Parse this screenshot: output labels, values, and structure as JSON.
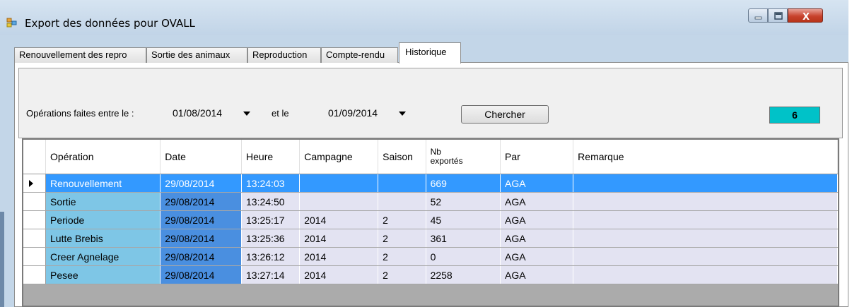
{
  "window": {
    "title": "Export des données pour OVALL",
    "close_symbol": "X"
  },
  "tabs": [
    {
      "label": "Renouvellement des repro"
    },
    {
      "label": "Sortie des animaux"
    },
    {
      "label": "Reproduction"
    },
    {
      "label": "Compte-rendu"
    },
    {
      "label": "Historique",
      "active": true
    }
  ],
  "filter": {
    "label_between": "Opérations faites entre le :",
    "date_from": "01/08/2014",
    "label_and": "et le",
    "date_to": "01/09/2014",
    "search_label": "Chercher",
    "count": "6"
  },
  "grid": {
    "columns": {
      "operation": "Opération",
      "date": "Date",
      "heure": "Heure",
      "campagne": "Campagne",
      "saison": "Saison",
      "nb_line1": "Nb",
      "nb_line2": "exportés",
      "par": "Par",
      "remarque": "Remarque"
    },
    "rows": [
      {
        "operation": "Renouvellement",
        "date": "29/08/2014",
        "heure": "13:24:03",
        "campagne": "",
        "saison": "",
        "nb": "669",
        "par": "AGA",
        "remarque": ""
      },
      {
        "operation": "Sortie",
        "date": "29/08/2014",
        "heure": "13:24:50",
        "campagne": "",
        "saison": "",
        "nb": "52",
        "par": "AGA",
        "remarque": ""
      },
      {
        "operation": "Periode",
        "date": "29/08/2014",
        "heure": "13:25:17",
        "campagne": "2014",
        "saison": "2",
        "nb": "45",
        "par": "AGA",
        "remarque": ""
      },
      {
        "operation": "Lutte Brebis",
        "date": "29/08/2014",
        "heure": "13:25:36",
        "campagne": "2014",
        "saison": "2",
        "nb": "361",
        "par": "AGA",
        "remarque": ""
      },
      {
        "operation": "Creer Agnelage",
        "date": "29/08/2014",
        "heure": "13:26:12",
        "campagne": "2014",
        "saison": "2",
        "nb": "0",
        "par": "AGA",
        "remarque": ""
      },
      {
        "operation": "Pesee",
        "date": "29/08/2014",
        "heure": "13:27:14",
        "campagne": "2014",
        "saison": "2",
        "nb": "2258",
        "par": "AGA",
        "remarque": ""
      }
    ]
  },
  "colors": {
    "selection": "#3399ff",
    "operation_column": "#7ec6e6",
    "date_column": "#4a8fe0",
    "count_box": "#00c2c8"
  },
  "icons": [
    "app-icon",
    "minimize-icon",
    "maximize-icon",
    "close-icon",
    "dropdown-arrow-icon",
    "row-pointer-icon"
  ]
}
